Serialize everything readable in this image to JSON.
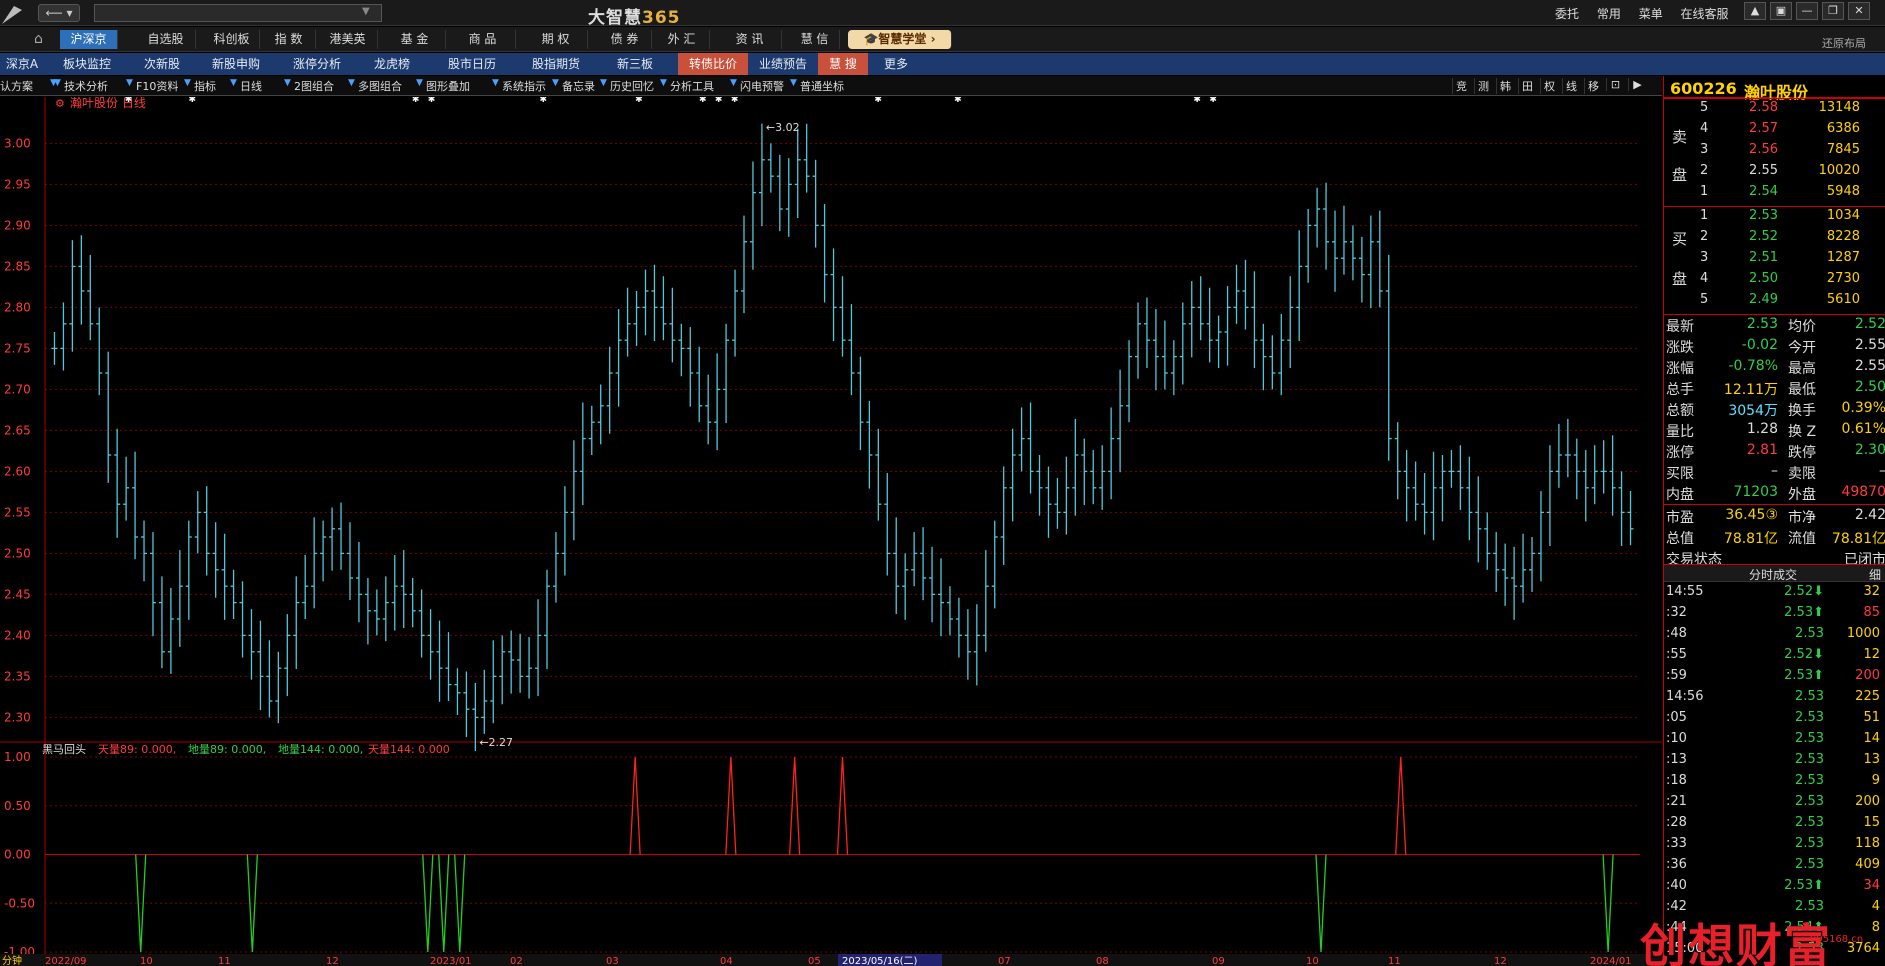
{
  "titlebar": {
    "app_name": "大智慧",
    "app_suffix": "365",
    "nav_arrows": "⟵ ▾",
    "menu": [
      "委托",
      "常用",
      "菜单",
      "在线客服"
    ],
    "window_buttons": [
      "▲",
      "▣",
      "—",
      "❐",
      "✕"
    ]
  },
  "market_tabs": [
    {
      "label": "沪深京",
      "active": true
    },
    {
      "label": "自选股"
    },
    {
      "label": "科创板"
    },
    {
      "label": "指  数"
    },
    {
      "label": "港美英"
    },
    {
      "label": "基  金"
    },
    {
      "label": "商  品"
    },
    {
      "label": "期  权"
    },
    {
      "label": "债  券"
    },
    {
      "label": "外  汇"
    },
    {
      "label": "资  讯"
    },
    {
      "label": "慧  信"
    },
    {
      "label": "🎓智慧学堂 ›",
      "promo": true
    }
  ],
  "restore_layout": "还原布局",
  "sub_tabs": [
    {
      "label": "深京A"
    },
    {
      "label": "板块监控"
    },
    {
      "label": "次新股"
    },
    {
      "label": "新股申购"
    },
    {
      "label": "涨停分析"
    },
    {
      "label": "龙虎榜"
    },
    {
      "label": "股市日历"
    },
    {
      "label": "股指期货"
    },
    {
      "label": "新三板"
    },
    {
      "label": "转债比价",
      "hl": true
    },
    {
      "label": "业绩预告"
    },
    {
      "label": "慧  搜",
      "hl": true
    },
    {
      "label": "更多"
    }
  ],
  "toolbar": {
    "left": [
      "认方案",
      "技术分析",
      "F10资料",
      "指标",
      "日线",
      "2图组合",
      "多图组合",
      "图形叠加",
      "系统指示",
      "备忘录",
      "历史回忆",
      "分析工具",
      "闪电预警",
      "普通坐标"
    ],
    "right": [
      "竞",
      "测",
      "韩",
      "田",
      "权",
      "线",
      "移",
      "⊡",
      "▶"
    ]
  },
  "chart": {
    "main_title": "瀚叶股份 日线",
    "high_label": "3.02",
    "low_label": "2.27",
    "price_ticks": [
      "3.00",
      "2.95",
      "2.90",
      "2.85",
      "2.80",
      "2.75",
      "2.70",
      "2.65",
      "2.60",
      "2.55",
      "2.50",
      "2.45",
      "2.40",
      "2.35",
      "2.30"
    ],
    "indicator_name": "黑马回头",
    "indicator_items": [
      {
        "label": "天量89: 0.000,",
        "color": "#ff3b3b"
      },
      {
        "label": "地量89: 0.000,",
        "color": "#2fd04a"
      },
      {
        "label": "地量144: 0.000,",
        "color": "#2fd04a"
      },
      {
        "label": "天量144: 0.000",
        "color": "#ff3b3b"
      }
    ],
    "ind_ticks": [
      "1.00",
      "0.50",
      "0.00",
      "-0.50",
      "-1.00"
    ],
    "date_labels": [
      "2022/09",
      "10",
      "11",
      "12",
      "2023/01",
      "02",
      "03",
      "04",
      "05",
      "2023/05/16(二)",
      "07",
      "08",
      "09",
      "10",
      "11",
      "12",
      "2024/01"
    ],
    "corner_label": "分钟"
  },
  "chart_data": {
    "type": "bar",
    "title": "瀚叶股份 日线",
    "subtitle": "",
    "xlabel": "",
    "ylabel": "",
    "ylim": [
      2.27,
      3.02
    ],
    "range_high": 3.02,
    "range_low": 2.27,
    "indicator_ylim": [
      -1,
      1
    ],
    "indicator_spikes_up": [
      0.37,
      0.43,
      0.47,
      0.5,
      0.85
    ],
    "indicator_spikes_down": [
      0.06,
      0.13,
      0.24,
      0.25,
      0.26,
      0.8,
      0.98
    ],
    "price_series": [
      2.75,
      2.78,
      2.85,
      2.82,
      2.78,
      2.72,
      2.62,
      2.56,
      2.58,
      2.52,
      2.5,
      2.44,
      2.38,
      2.42,
      2.46,
      2.52,
      2.55,
      2.5,
      2.48,
      2.46,
      2.44,
      2.4,
      2.38,
      2.35,
      2.32,
      2.36,
      2.4,
      2.44,
      2.46,
      2.5,
      2.52,
      2.53,
      2.5,
      2.47,
      2.45,
      2.43,
      2.42,
      2.44,
      2.46,
      2.45,
      2.43,
      2.4,
      2.38,
      2.36,
      2.34,
      2.33,
      2.31,
      2.3,
      2.32,
      2.35,
      2.38,
      2.37,
      2.35,
      2.36,
      2.4,
      2.46,
      2.5,
      2.55,
      2.6,
      2.64,
      2.66,
      2.68,
      2.72,
      2.76,
      2.78,
      2.8,
      2.82,
      2.8,
      2.78,
      2.76,
      2.75,
      2.72,
      2.68,
      2.66,
      2.7,
      2.76,
      2.82,
      2.88,
      2.94,
      2.98,
      2.96,
      2.92,
      2.95,
      2.98,
      2.96,
      2.9,
      2.84,
      2.8,
      2.76,
      2.72,
      2.66,
      2.62,
      2.56,
      2.5,
      2.46,
      2.48,
      2.5,
      2.47,
      2.45,
      2.44,
      2.42,
      2.4,
      2.38,
      2.4,
      2.46,
      2.52,
      2.58,
      2.62,
      2.64,
      2.6,
      2.58,
      2.56,
      2.55,
      2.58,
      2.62,
      2.6,
      2.58,
      2.6,
      2.64,
      2.68,
      2.74,
      2.78,
      2.76,
      2.74,
      2.72,
      2.74,
      2.78,
      2.8,
      2.78,
      2.76,
      2.77,
      2.8,
      2.82,
      2.8,
      2.76,
      2.74,
      2.72,
      2.76,
      2.8,
      2.85,
      2.9,
      2.92,
      2.88,
      2.86,
      2.88,
      2.86,
      2.84,
      2.88,
      2.82,
      2.64,
      2.6,
      2.58,
      2.56,
      2.55,
      2.58,
      2.6,
      2.6,
      2.58,
      2.55,
      2.53,
      2.5,
      2.48,
      2.47,
      2.46,
      2.48,
      2.5,
      2.55,
      2.6,
      2.62,
      2.62,
      2.6,
      2.58,
      2.6,
      2.6,
      2.58,
      2.55,
      2.53
    ]
  },
  "stock": {
    "code": "600226",
    "name": "瀚叶股份"
  },
  "orderbook": {
    "sell_label": [
      "卖",
      "盘"
    ],
    "buy_label": [
      "买",
      "盘"
    ],
    "sell": [
      {
        "lv": "5",
        "price": "2.58",
        "vol": "13148",
        "c": "red"
      },
      {
        "lv": "4",
        "price": "2.57",
        "vol": "6386",
        "c": "red"
      },
      {
        "lv": "3",
        "price": "2.56",
        "vol": "7845",
        "c": "red"
      },
      {
        "lv": "2",
        "price": "2.55",
        "vol": "10020",
        "c": "wht"
      },
      {
        "lv": "1",
        "price": "2.54",
        "vol": "5948",
        "c": "grn"
      }
    ],
    "buy": [
      {
        "lv": "1",
        "price": "2.53",
        "vol": "1034",
        "c": "grn"
      },
      {
        "lv": "2",
        "price": "2.52",
        "vol": "8228",
        "c": "grn"
      },
      {
        "lv": "3",
        "price": "2.51",
        "vol": "1287",
        "c": "grn"
      },
      {
        "lv": "4",
        "price": "2.50",
        "vol": "2730",
        "c": "grn"
      },
      {
        "lv": "5",
        "price": "2.49",
        "vol": "5610",
        "c": "grn"
      }
    ]
  },
  "quote": [
    {
      "k": "最新",
      "v": "2.53",
      "vc": "grn",
      "k2": "均价",
      "v2": "2.52",
      "v2c": "grn"
    },
    {
      "k": "涨跌",
      "v": "-0.02",
      "vc": "grn",
      "k2": "今开",
      "v2": "2.55",
      "v2c": "wht"
    },
    {
      "k": "涨幅",
      "v": "-0.78%",
      "vc": "grn",
      "k2": "最高",
      "v2": "2.55",
      "v2c": "wht"
    },
    {
      "k": "总手",
      "v": "12.11万",
      "vc": "yel",
      "k2": "最低",
      "v2": "2.50",
      "v2c": "grn"
    },
    {
      "k": "总额",
      "v": "3054万",
      "vc": "cyan",
      "k2": "换手",
      "v2": "0.39%",
      "v2c": "yel"
    },
    {
      "k": "量比",
      "v": "1.28",
      "vc": "wht",
      "k2": "换 Z",
      "v2": "0.61%",
      "v2c": "yel"
    },
    {
      "k": "涨停",
      "v": "2.81",
      "vc": "red",
      "k2": "跌停",
      "v2": "2.30",
      "v2c": "grn"
    },
    {
      "k": "买限",
      "v": "–",
      "vc": "wht",
      "k2": "卖限",
      "v2": "–",
      "v2c": "wht"
    },
    {
      "k": "内盘",
      "v": "71203",
      "vc": "grn",
      "k2": "外盘",
      "v2": "49870",
      "v2c": "red"
    },
    {
      "k": "市盈",
      "v": "36.45③",
      "vc": "yel",
      "k2": "市净",
      "v2": "2.42",
      "v2c": "wht"
    },
    {
      "k": "总值",
      "v": "78.81亿",
      "vc": "yel",
      "k2": "流值",
      "v2": "78.81亿",
      "v2c": "yel"
    },
    {
      "k": "交易状态",
      "v": "",
      "vc": "wht",
      "k2": "",
      "v2": "已闭市",
      "v2c": "wht"
    }
  ],
  "ticks_header": {
    "title": "分时成交",
    "detail": "细"
  },
  "ticks": [
    {
      "t": "14:55",
      "p": "2.52⬇",
      "pc": "grn",
      "v": "32"
    },
    {
      "t": ":32",
      "p": "2.53⬆",
      "pc": "grn",
      "v": "85",
      "vc": "red"
    },
    {
      "t": ":48",
      "p": "2.53",
      "pc": "grn",
      "v": "1000"
    },
    {
      "t": ":55",
      "p": "2.52⬇",
      "pc": "grn",
      "v": "12"
    },
    {
      "t": ":59",
      "p": "2.53⬆",
      "pc": "grn",
      "v": "200",
      "vc": "red"
    },
    {
      "t": "14:56",
      "p": "2.53",
      "pc": "grn",
      "v": "225"
    },
    {
      "t": ":05",
      "p": "2.53",
      "pc": "grn",
      "v": "51"
    },
    {
      "t": ":10",
      "p": "2.53",
      "pc": "grn",
      "v": "14"
    },
    {
      "t": ":13",
      "p": "2.53",
      "pc": "grn",
      "v": "13"
    },
    {
      "t": ":18",
      "p": "2.53",
      "pc": "grn",
      "v": "9"
    },
    {
      "t": ":21",
      "p": "2.53",
      "pc": "grn",
      "v": "200"
    },
    {
      "t": ":28",
      "p": "2.53",
      "pc": "grn",
      "v": "15"
    },
    {
      "t": ":33",
      "p": "2.53",
      "pc": "grn",
      "v": "118"
    },
    {
      "t": ":36",
      "p": "2.53",
      "pc": "grn",
      "v": "409"
    },
    {
      "t": ":40",
      "p": "2.53⬆",
      "pc": "grn",
      "v": "34",
      "vc": "red"
    },
    {
      "t": ":42",
      "p": "2.53",
      "pc": "grn",
      "v": "4"
    },
    {
      "t": ":44",
      "p": "2.54⬆",
      "pc": "grn",
      "v": "8"
    },
    {
      "t": "15:00",
      "p": "2.53",
      "pc": "grn",
      "v": "3764"
    }
  ],
  "watermark": {
    "text": "创想财富",
    "url": "995168.cn"
  },
  "colors": {
    "candle": "#4fc8d8",
    "grid_red": "#7a0000",
    "up_spike": "#ff2020",
    "down_spike": "#20d020",
    "accent_tab": "#2d6fb8"
  }
}
